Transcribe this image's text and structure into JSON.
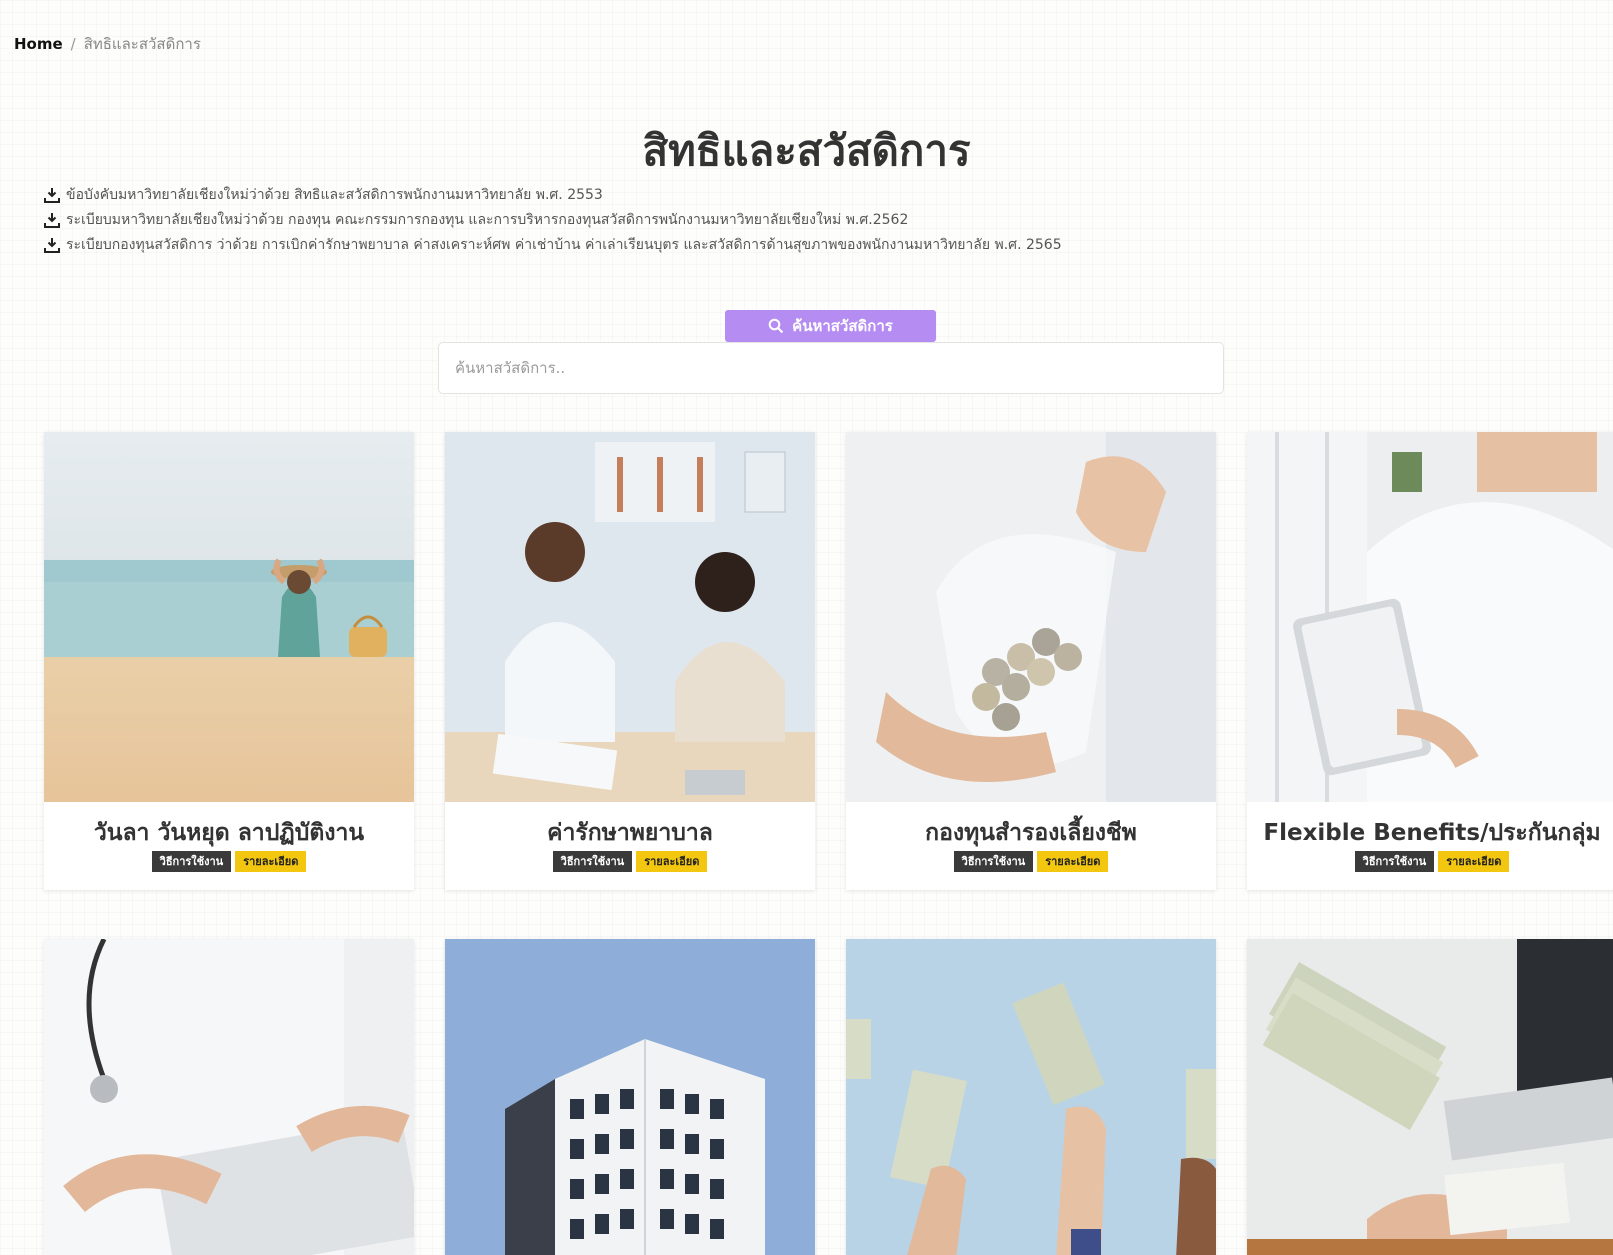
{
  "breadcrumb": {
    "home": "Home",
    "separator": "/",
    "current": "สิทธิและสวัสดิการ"
  },
  "page_title": "สิทธิและสวัสดิการ",
  "documents": [
    "ข้อบังคับมหาวิทยาลัยเชียงใหม่ว่าด้วย สิทธิและสวัสดิการพนักงานมหาวิทยาลัย พ.ศ. 2553",
    "ระเบียบมหาวิทยาลัยเชียงใหม่ว่าด้วย กองทุน คณะกรรมการกองทุน และการบริหารกองทุนสวัสดิการพนักงานมหาวิทยาลัยเชียงใหม่ พ.ศ.2562",
    "ระเบียบกองทุนสวัสดิการ ว่าด้วย การเบิกค่ารักษาพยาบาล ค่าสงเคราะห์ศพ ค่าเช่าบ้าน ค่าเล่าเรียนบุตร และสวัสดิการด้านสุขภาพของพนักงานมหาวิทยาลัย พ.ศ. 2565"
  ],
  "search": {
    "button_label": "ค้นหาสวัสดิการ",
    "placeholder": "ค้นหาสวัสดิการ.."
  },
  "cards": [
    {
      "title": "วันลา วันหยุด ลาปฏิบัติงาน",
      "badge_usage": "วิธีการใช้งาน",
      "badge_details": "รายละเอียด",
      "image": "beach-photo"
    },
    {
      "title": "ค่ารักษาพยาบาล",
      "badge_usage": "วิธีการใช้งาน",
      "badge_details": "รายละเอียด",
      "image": "doctor-patient-photo"
    },
    {
      "title": "กองทุนสำรองเลี้ยงชีพ",
      "badge_usage": "วิธีการใช้งาน",
      "badge_details": "รายละเอียด",
      "image": "coin-jar-photo"
    },
    {
      "title": "Flexible Benefits/ประกันกลุ่ม",
      "badge_usage": "วิธีการใช้งาน",
      "badge_details": "รายละเอียด",
      "image": "doctor-tablet-photo"
    },
    {
      "title": "",
      "image": "doctor-writing-photo"
    },
    {
      "title": "",
      "image": "building-photo"
    },
    {
      "title": "",
      "image": "money-hands-photo"
    },
    {
      "title": "",
      "image": "cash-counting-photo"
    }
  ],
  "colors": {
    "accent_purple": "#b58cf2",
    "badge_dark": "#3a3a3a",
    "badge_yellow": "#f3c710"
  }
}
